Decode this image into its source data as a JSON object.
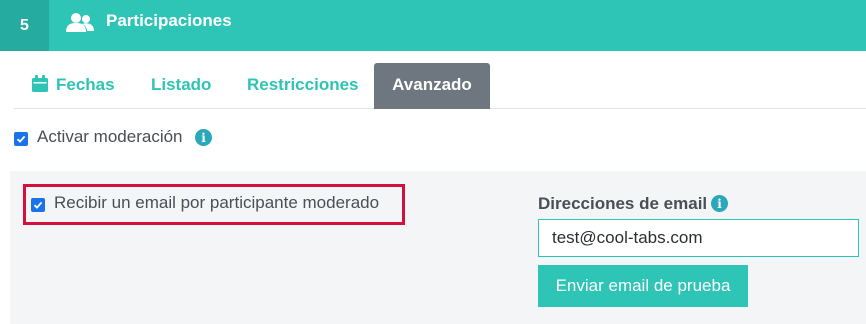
{
  "header": {
    "step_number": "5",
    "icon": "users-icon",
    "title": "Participaciones",
    "color": "#2ec4b6"
  },
  "tabs": [
    {
      "label": "Fechas",
      "icon": "calendar-icon",
      "active": false
    },
    {
      "label": "Listado",
      "active": false
    },
    {
      "label": "Restricciones",
      "active": false
    },
    {
      "label": "Avanzado",
      "active": true
    }
  ],
  "moderation": {
    "label": "Activar moderación",
    "checked": true,
    "info_icon": "info-icon"
  },
  "email_notify": {
    "label": "Recibir un email por participante moderado",
    "checked": true,
    "highlight_color": "#d40f3e"
  },
  "email_addresses": {
    "label": "Direcciones de email",
    "info_icon": "info-icon",
    "value": "test@cool-tabs.com"
  },
  "send_test_button": {
    "label": "Enviar email de prueba"
  }
}
